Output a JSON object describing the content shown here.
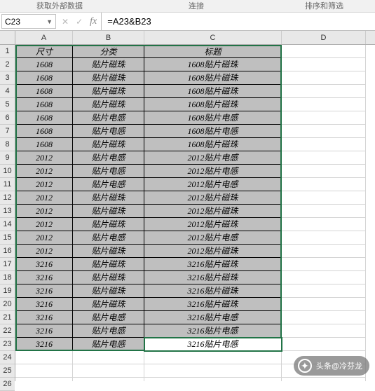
{
  "ribbon": {
    "group1": "获取外部数据",
    "group2": "连接",
    "group3": "排序和筛选"
  },
  "formula_bar": {
    "name_box": "C23",
    "formula": "=A23&B23"
  },
  "columns": [
    "A",
    "B",
    "C",
    "D"
  ],
  "headers": {
    "col_a": "尺寸",
    "col_b": "分类",
    "col_c": "标题"
  },
  "rows": [
    {
      "a": "1608",
      "b": "贴片磁珠",
      "c": "1608贴片磁珠"
    },
    {
      "a": "1608",
      "b": "贴片磁珠",
      "c": "1608贴片磁珠"
    },
    {
      "a": "1608",
      "b": "贴片磁珠",
      "c": "1608贴片磁珠"
    },
    {
      "a": "1608",
      "b": "贴片磁珠",
      "c": "1608贴片磁珠"
    },
    {
      "a": "1608",
      "b": "贴片电感",
      "c": "1608贴片电感"
    },
    {
      "a": "1608",
      "b": "贴片电感",
      "c": "1608贴片电感"
    },
    {
      "a": "1608",
      "b": "贴片磁珠",
      "c": "1608贴片磁珠"
    },
    {
      "a": "2012",
      "b": "贴片电感",
      "c": "2012贴片电感"
    },
    {
      "a": "2012",
      "b": "贴片电感",
      "c": "2012贴片电感"
    },
    {
      "a": "2012",
      "b": "贴片电感",
      "c": "2012贴片电感"
    },
    {
      "a": "2012",
      "b": "贴片磁珠",
      "c": "2012贴片磁珠"
    },
    {
      "a": "2012",
      "b": "贴片磁珠",
      "c": "2012贴片磁珠"
    },
    {
      "a": "2012",
      "b": "贴片磁珠",
      "c": "2012贴片磁珠"
    },
    {
      "a": "2012",
      "b": "贴片电感",
      "c": "2012贴片电感"
    },
    {
      "a": "2012",
      "b": "贴片磁珠",
      "c": "2012贴片磁珠"
    },
    {
      "a": "3216",
      "b": "贴片磁珠",
      "c": "3216贴片磁珠"
    },
    {
      "a": "3216",
      "b": "贴片磁珠",
      "c": "3216贴片磁珠"
    },
    {
      "a": "3216",
      "b": "贴片磁珠",
      "c": "3216贴片磁珠"
    },
    {
      "a": "3216",
      "b": "贴片磁珠",
      "c": "3216贴片磁珠"
    },
    {
      "a": "3216",
      "b": "贴片电感",
      "c": "3216贴片电感"
    },
    {
      "a": "3216",
      "b": "贴片电感",
      "c": "3216贴片电感"
    },
    {
      "a": "3216",
      "b": "贴片电感",
      "c": "3216贴片电感"
    }
  ],
  "empty_row_count": 3,
  "active_cell": {
    "row": 23,
    "col": "C"
  },
  "watermark": {
    "source": "头条@冷芬龙"
  }
}
